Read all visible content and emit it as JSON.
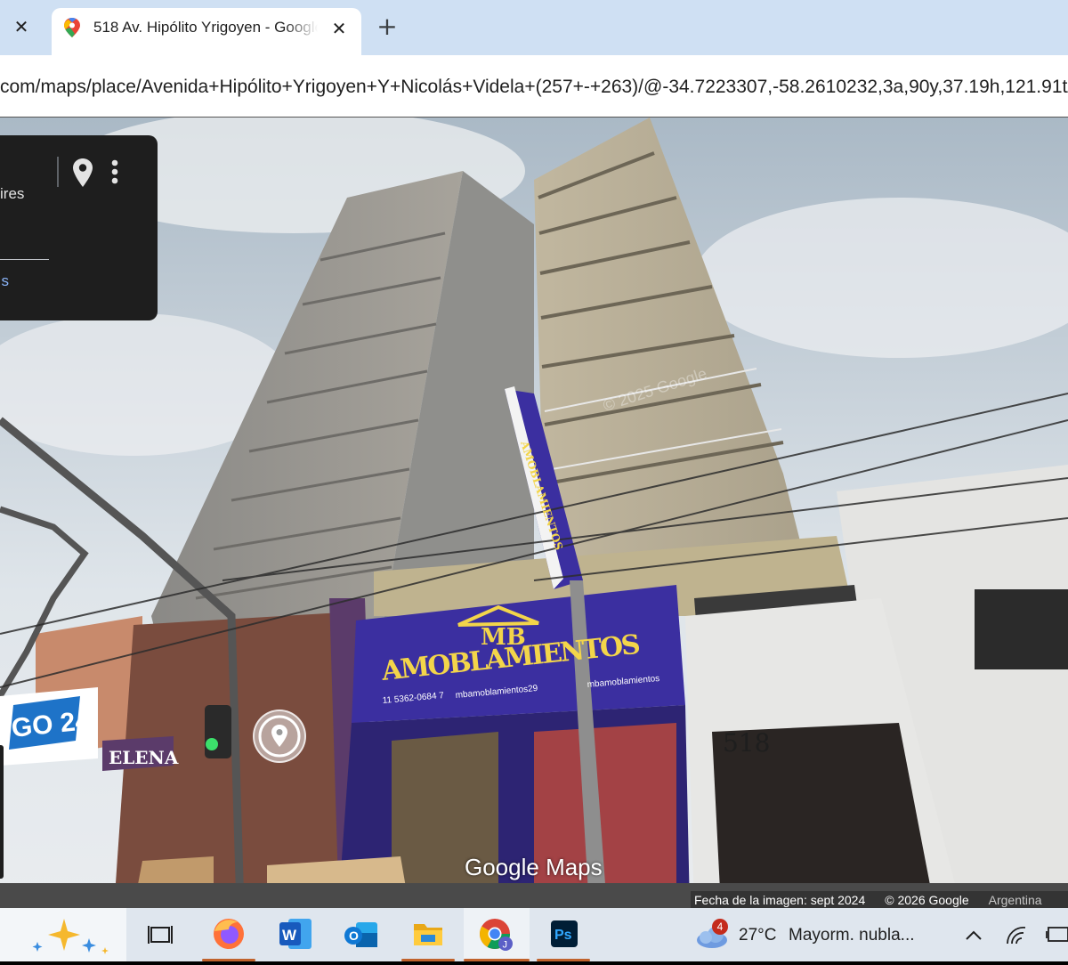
{
  "browser": {
    "tab": {
      "title": "518 Av. Hipólito Yrigoyen - Google Maps",
      "favicon": "google-maps-pin-icon"
    },
    "url": "com/maps/place/Avenida+Hipólito+Yrigoyen+Y+Nicolás+Videla+(257+-+263)/@-34.7223307,-58.2610232,3a,90y,37.19h,121.91t/"
  },
  "info_card": {
    "subtitle": "ires",
    "link": "s"
  },
  "scene": {
    "sign_brand": "MB",
    "sign_name": "AMOBLAMIENTOS",
    "sign_phone": "11 5362-0684 7",
    "sign_instagram": "mbamoblamientos29",
    "sign_facebook": "mbamoblamientos",
    "pole_sign_text": "AMOBLAMIENTOS",
    "building_number": "518",
    "left_shop": "ELENA",
    "left_sign": "GO 24",
    "watermark": "© 2025 Google"
  },
  "maps": {
    "wordmark": "Google Maps",
    "image_date": "Fecha de la imagen: sept 2024",
    "copyright": "© 2026 Google",
    "country": "Argentina"
  },
  "taskbar": {
    "weather_badge": "4",
    "temperature": "27°C",
    "weather_text": "Mayorm. nubla..."
  },
  "colors": {
    "tabbar_bg": "#cfe0f3",
    "card_bg": "#1e1e1e",
    "link": "#8ab4f8",
    "sign_purple": "#3b2fa0",
    "sign_yellow": "#f3d54a",
    "taskbar_bg": "#dfe6ee",
    "active_indicator": "#c0622c"
  }
}
